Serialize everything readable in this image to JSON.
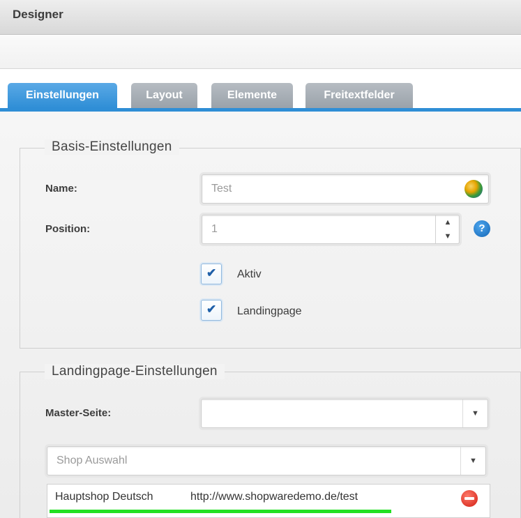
{
  "window": {
    "title": "Designer"
  },
  "tabs": [
    {
      "label": "Einstellungen",
      "active": true
    },
    {
      "label": "Layout",
      "active": false
    },
    {
      "label": "Elemente",
      "active": false
    },
    {
      "label": "Freitextfelder",
      "active": false
    }
  ],
  "basis": {
    "legend": "Basis-Einstellungen",
    "name_label": "Name:",
    "name_value": "Test",
    "position_label": "Position:",
    "position_value": "1",
    "aktiv_label": "Aktiv",
    "aktiv_checked": true,
    "landingpage_label": "Landingpage",
    "landingpage_checked": true
  },
  "landingpage": {
    "legend": "Landingpage-Einstellungen",
    "master_label": "Master-Seite:",
    "master_value": "",
    "shop_placeholder": "Shop Auswahl",
    "shops": [
      {
        "name": "Hauptshop Deutsch",
        "url": "http://www.shopwaredemo.de/test"
      }
    ]
  },
  "icons": {
    "translate": "globe-icon",
    "help": "help-icon",
    "remove": "remove-icon",
    "check": "✔",
    "arrow_down": "▼",
    "arrow_up": "▲"
  },
  "colors": {
    "accent": "#2f8ed6",
    "remove": "#d11d12",
    "progress": "#22e022"
  }
}
